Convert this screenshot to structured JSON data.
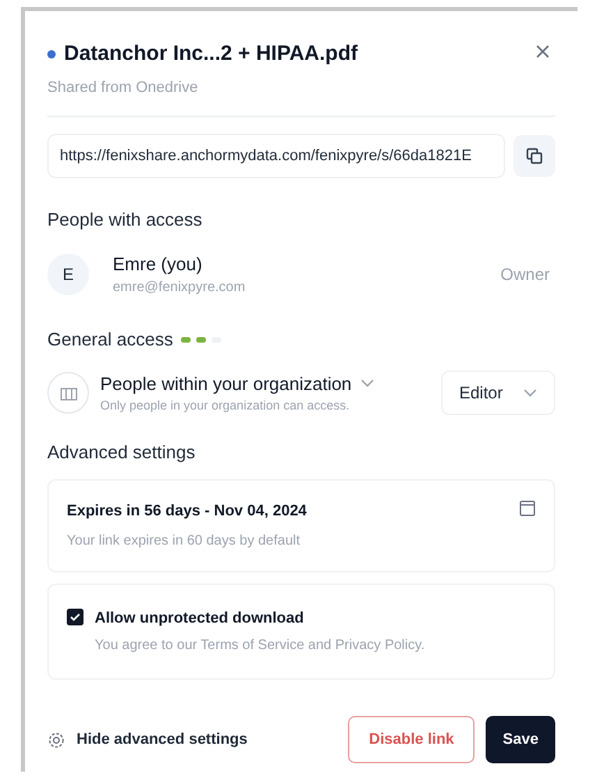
{
  "dialog": {
    "title": "Datanchor Inc...2 + HIPAA.pdf",
    "subtitle": "Shared from Onedrive",
    "link": "https://fenixshare.anchormydata.com/fenixpyre/s/66da1821E"
  },
  "people_section": {
    "heading": "People with access",
    "people": [
      {
        "initial": "E",
        "name": "Emre (you)",
        "email": "emre@fenixpyre.com",
        "role": "Owner"
      }
    ]
  },
  "general_access": {
    "heading": "General access",
    "progress_dots": [
      {
        "on": true
      },
      {
        "on": true
      },
      {
        "on": false
      }
    ],
    "scope": "People within your organization",
    "scope_hint": "Only people in your organization can access.",
    "permission": "Editor"
  },
  "advanced": {
    "heading": "Advanced settings",
    "expiry": {
      "title": "Expires in 56 days - Nov 04, 2024",
      "hint": "Your link expires in 60 days by default"
    },
    "download": {
      "label": "Allow unprotected download",
      "hint": "You agree to our Terms of Service and Privacy Policy.",
      "checked": true
    }
  },
  "footer": {
    "toggle": "Hide advanced settings",
    "disable": "Disable link",
    "save": "Save"
  }
}
